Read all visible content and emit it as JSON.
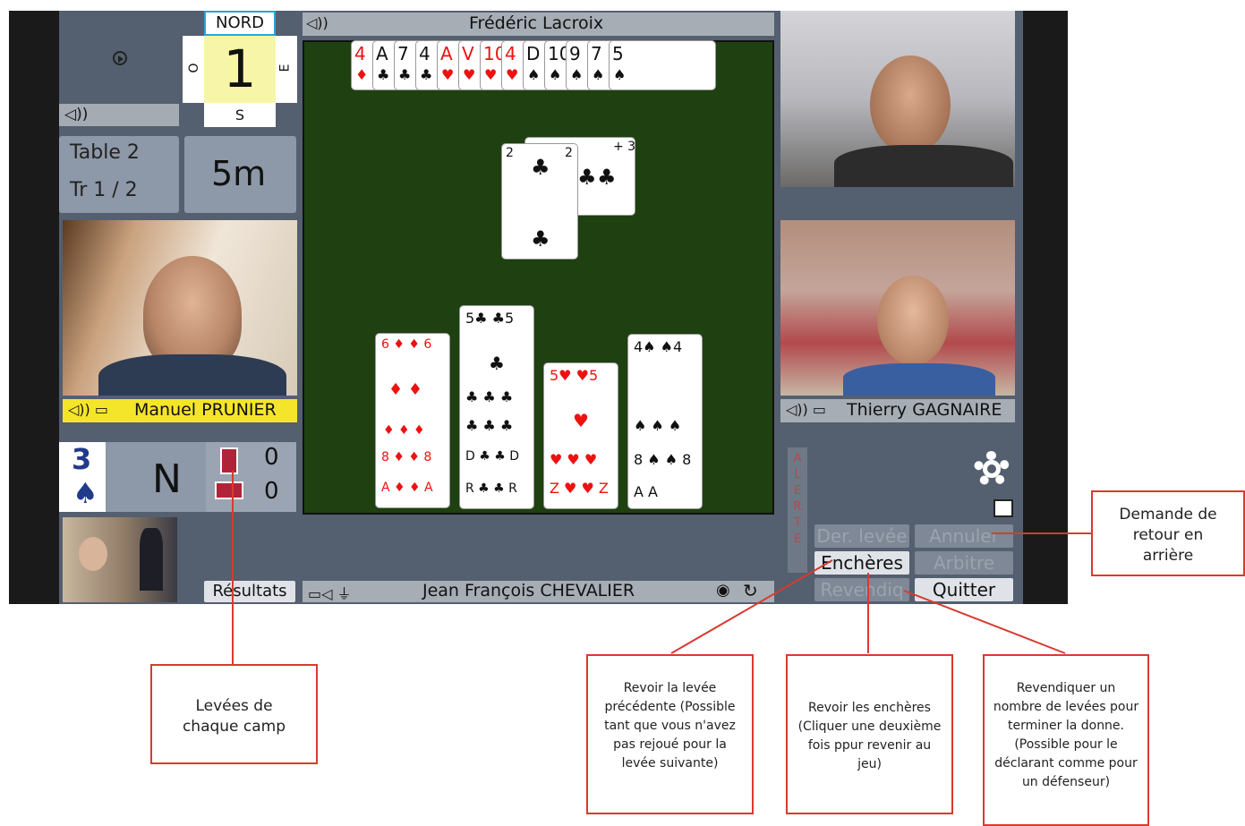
{
  "north_label": "NORD",
  "contract_level_display": "1",
  "compass": {
    "west": "O",
    "east": "E",
    "south": "S"
  },
  "table_info": {
    "table": "Table 2",
    "round": "Tr 1 / 2",
    "timer": "5m"
  },
  "players": {
    "north": "Frédéric Lacroix",
    "west": "Manuel PRUNIER",
    "east": "Thierry GAGNAIRE",
    "south": "Jean François CHEVALIER"
  },
  "north_hand": [
    {
      "rank": "4",
      "suit": "♦",
      "color": "red"
    },
    {
      "rank": "A",
      "suit": "♣",
      "color": "black"
    },
    {
      "rank": "7",
      "suit": "♣",
      "color": "black"
    },
    {
      "rank": "4",
      "suit": "♣",
      "color": "black"
    },
    {
      "rank": "A",
      "suit": "♥",
      "color": "red"
    },
    {
      "rank": "V",
      "suit": "♥",
      "color": "red"
    },
    {
      "rank": "10",
      "suit": "♥",
      "color": "red"
    },
    {
      "rank": "4",
      "suit": "♥",
      "color": "red"
    },
    {
      "rank": "D",
      "suit": "♠",
      "color": "black"
    },
    {
      "rank": "10",
      "suit": "♠",
      "color": "black"
    },
    {
      "rank": "9",
      "suit": "♠",
      "color": "black"
    },
    {
      "rank": "7",
      "suit": "♠",
      "color": "black"
    },
    {
      "rank": "5",
      "suit": "♠",
      "color": "black"
    }
  ],
  "contract": {
    "level": "3",
    "suit": "♠",
    "declarer": "N"
  },
  "tricks": {
    "ns": "0",
    "ew": "0"
  },
  "alert_label": "ALERTE",
  "buttons": {
    "last_trick": "Der. levée",
    "undo": "Annuler",
    "bidding": "Enchères",
    "referee": "Arbitre",
    "claim": "Revendiq",
    "quit": "Quitter",
    "results": "Résultats"
  },
  "callouts": {
    "undo_request": "Demande de retour en arrière",
    "tricks_each_side": "Levées de chaque camp",
    "review_last_trick": "Revoir la levée précédente (Possible tant que vous n'avez pas rejoué pour la levée suivante)",
    "review_bidding": "Revoir les enchères (Cliquer une deuxième fois ppur revenir au jeu)",
    "claim_help": "Revendiquer un nombre de levées pour terminer la donne. (Possible pour le déclarant comme pour un défenseur)"
  },
  "colors": {
    "felt": "#1f4010",
    "callout_border": "#d93a2f",
    "player_highlight": "#f5e52a"
  }
}
